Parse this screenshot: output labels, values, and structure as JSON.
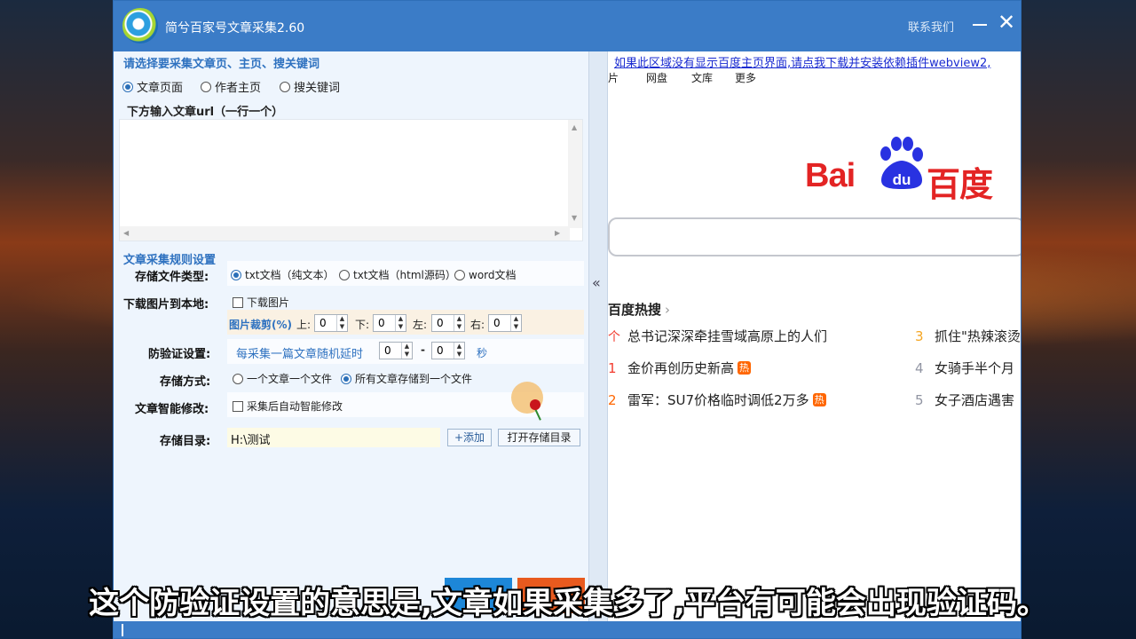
{
  "window": {
    "title": "简兮百家号文章采集2.60",
    "contact": "联系我们",
    "close": "✕"
  },
  "left": {
    "select_title": "请选择要采集文章页、主页、搜关键词",
    "modes": [
      {
        "label": "文章页面",
        "checked": true
      },
      {
        "label": "作者主页",
        "checked": false
      },
      {
        "label": "搜关键词",
        "checked": false
      }
    ],
    "url_title": "下方输入文章url（一行一个）",
    "url_value": "",
    "rules_title": "文章采集规则设置",
    "file_type": {
      "label": "存储文件类型:",
      "options": [
        {
          "label": "txt文档（纯文本）",
          "checked": true
        },
        {
          "label": "txt文档（html源码）",
          "checked": false
        },
        {
          "label": "word文档",
          "checked": false
        }
      ]
    },
    "download_images": {
      "label": "下载图片到本地:",
      "checkbox": "下载图片",
      "checked": false,
      "crop_label": "图片裁剪(%)",
      "top_label": "上:",
      "top_value": "0",
      "bottom_label": "下:",
      "bottom_value": "0",
      "left_label": "左:",
      "left_value": "0",
      "right_label": "右:",
      "right_value": "0"
    },
    "anti_verify": {
      "label": "防验证设置:",
      "text": "每采集一篇文章随机延时",
      "min": "0",
      "dash": "-",
      "max": "0",
      "unit": "秒"
    },
    "storage_mode": {
      "label": "存储方式:",
      "options": [
        {
          "label": "一个文章一个文件",
          "checked": false
        },
        {
          "label": "所有文章存储到一个文件",
          "checked": true
        }
      ]
    },
    "smart_edit": {
      "label": "文章智能修改:",
      "checkbox": "采集后自动智能修改",
      "checked": false
    },
    "storage_dir": {
      "label": "存储目录:",
      "value": "H:\\测试",
      "add_button": "+添加",
      "open_button": "打开存储目录"
    }
  },
  "divider": {
    "collapse": "«"
  },
  "browser": {
    "webview_link": "如果此区域没有显示百度主页界面,请点我下载并安装依赖插件webview2,",
    "nav": [
      "图片",
      "网盘",
      "文库",
      "更多"
    ],
    "logo_text_left": "Bai",
    "logo_text_du": "du",
    "logo_text_right": "百度",
    "hot_title": "百度热搜",
    "hot_chevron": "›",
    "hot_items": [
      {
        "num": "个",
        "title": "总书记深深牵挂雪域高原上的人们",
        "tag": ""
      },
      {
        "num": "1",
        "title": "金价再创历史新高",
        "tag": "热"
      },
      {
        "num": "2",
        "title": "雷军：SU7价格临时调低2万多",
        "tag": "热"
      },
      {
        "num": "3",
        "title": "抓住\"热辣滚烫",
        "tag": ""
      },
      {
        "num": "4",
        "title": "女骑手半个月",
        "tag": ""
      },
      {
        "num": "5",
        "title": "女子酒店遇害",
        "tag": ""
      }
    ],
    "colors": {
      "red": "#e32424",
      "blue": "#2932e1",
      "hot_num_red": "#f23b2e",
      "hot_num_orange": "#f5a623",
      "hot_num_grey": "#9195a3"
    }
  },
  "subtitle": "这个防验证设置的意思是,文章如果采集多了,平台有可能会出现验证码。"
}
